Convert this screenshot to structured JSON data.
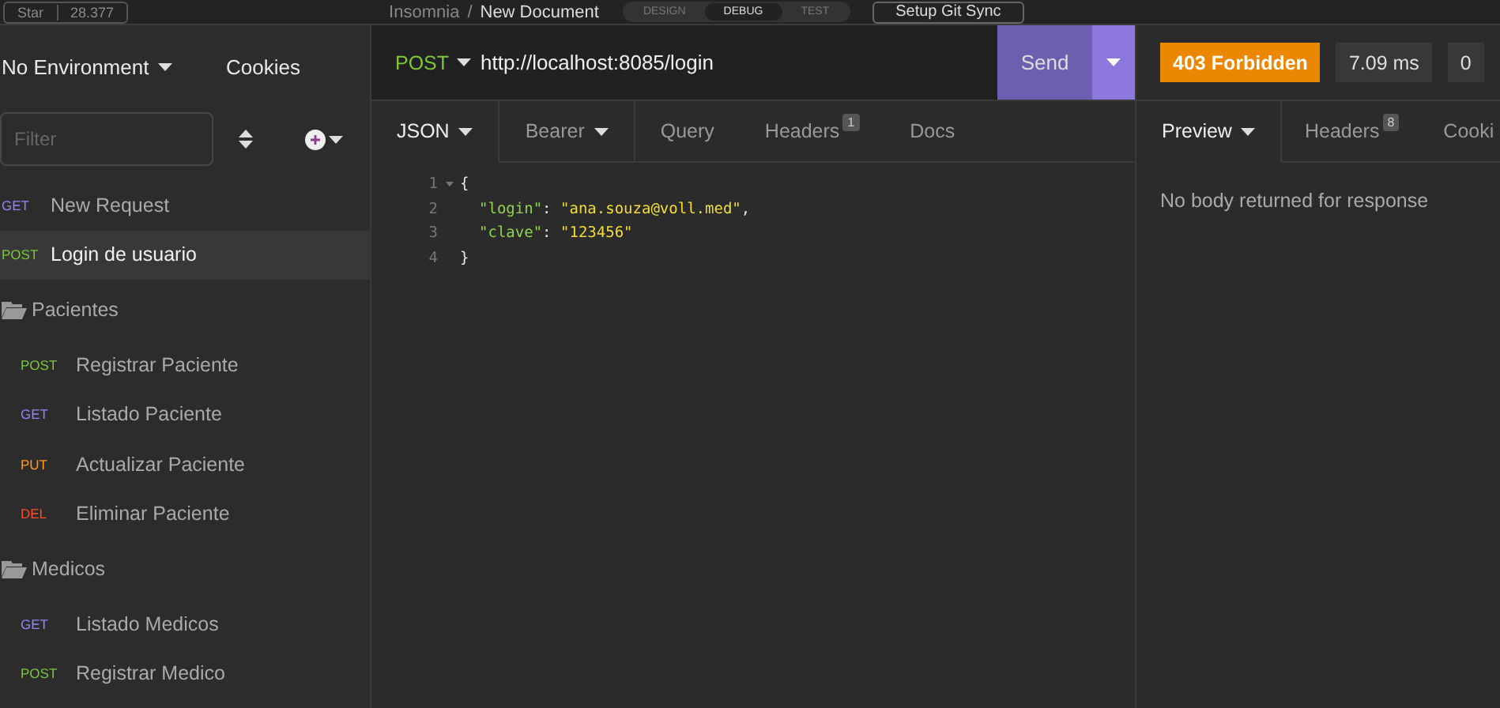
{
  "top_bar": {
    "github": {
      "star": "Star",
      "count": "28.377"
    },
    "breadcrumb": {
      "app": "Insomnia",
      "separator": "/",
      "document": "New Document"
    },
    "modes": [
      {
        "label": "DESIGN",
        "selected": false
      },
      {
        "label": "DEBUG",
        "selected": true
      },
      {
        "label": "TEST",
        "selected": false
      }
    ],
    "git_sync": "Setup Git Sync"
  },
  "sidebar": {
    "environment": "No Environment",
    "cookies": "Cookies",
    "filter": {
      "placeholder": "Filter"
    },
    "items": [
      {
        "kind": "request",
        "method": "GET",
        "name": "New Request",
        "selected": false
      },
      {
        "kind": "request",
        "method": "POST",
        "name": "Login de usuario",
        "selected": true
      },
      {
        "kind": "folder",
        "name": "Pacientes",
        "expanded": true,
        "children": [
          {
            "kind": "request",
            "method": "POST",
            "name": "Registrar Paciente",
            "selected": false
          },
          {
            "kind": "request",
            "method": "GET",
            "name": "Listado Paciente",
            "selected": false
          },
          {
            "kind": "request",
            "method": "PUT",
            "name": "Actualizar Paciente",
            "selected": false
          },
          {
            "kind": "request",
            "method": "DEL",
            "name": "Eliminar Paciente",
            "selected": false
          }
        ]
      },
      {
        "kind": "folder",
        "name": "Medicos",
        "expanded": true,
        "children": [
          {
            "kind": "request",
            "method": "GET",
            "name": "Listado Medicos",
            "selected": false
          },
          {
            "kind": "request",
            "method": "POST",
            "name": "Registrar Medico",
            "selected": false
          }
        ]
      }
    ]
  },
  "request": {
    "method": "POST",
    "url": "http://localhost:8085/login",
    "send": "Send",
    "tabs": [
      {
        "label": "JSON",
        "dropdown": true,
        "selected": true
      },
      {
        "label": "Bearer",
        "dropdown": true,
        "selected": false
      },
      {
        "label": "Query",
        "dropdown": false,
        "selected": false
      },
      {
        "label": "Headers",
        "badge": "1",
        "dropdown": false,
        "selected": false
      },
      {
        "label": "Docs",
        "dropdown": false,
        "selected": false
      }
    ],
    "editor": [
      {
        "number": "1",
        "foldable": true,
        "tokens": [
          {
            "kind": "punct",
            "text": "{"
          }
        ]
      },
      {
        "number": "2",
        "foldable": false,
        "tokens": [
          {
            "kind": "key",
            "text": "\"login\""
          },
          {
            "kind": "punct",
            "text": ": "
          },
          {
            "kind": "string",
            "text": "\"ana.souza@voll.med\""
          },
          {
            "kind": "punct",
            "text": ","
          }
        ]
      },
      {
        "number": "3",
        "foldable": false,
        "tokens": [
          {
            "kind": "key",
            "text": "\"clave\""
          },
          {
            "kind": "punct",
            "text": ": "
          },
          {
            "kind": "string",
            "text": "\"123456\""
          }
        ]
      },
      {
        "number": "4",
        "foldable": false,
        "tokens": [
          {
            "kind": "punct",
            "text": "}"
          }
        ]
      }
    ]
  },
  "response": {
    "status": "403 Forbidden",
    "time": "7.09 ms",
    "size": "0",
    "tabs": [
      {
        "label": "Preview",
        "dropdown": true,
        "selected": true
      },
      {
        "label": "Headers",
        "badge": "8",
        "dropdown": false,
        "selected": false
      },
      {
        "label": "Cooki",
        "selected": false
      }
    ],
    "message": "No body returned for response"
  }
}
